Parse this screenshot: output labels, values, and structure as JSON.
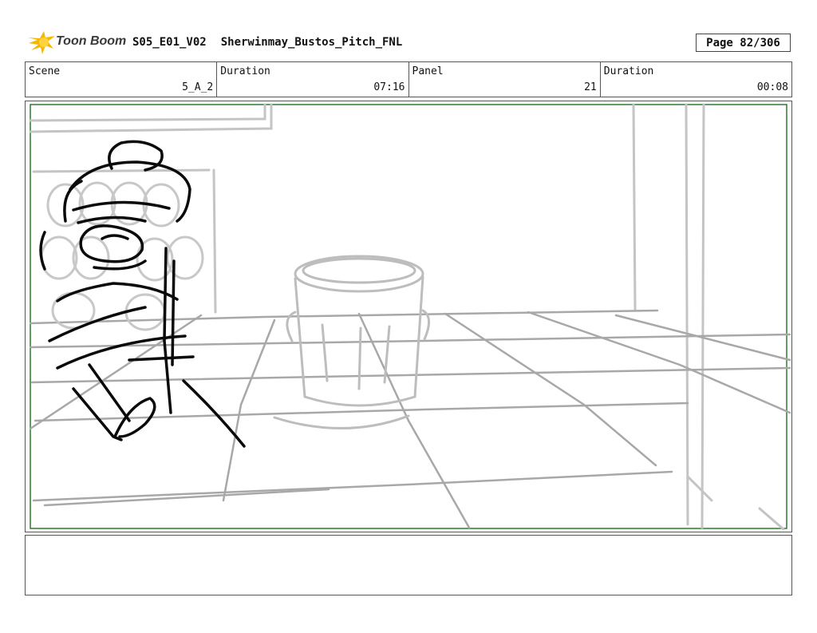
{
  "header": {
    "logo_text": "Toon Boom",
    "episode": "S05_E01_V02",
    "project": "Sherwinmay_Bustos_Pitch_FNL",
    "page": "Page  82/306"
  },
  "info_row": [
    {
      "label": "Scene",
      "value": "5_A_2"
    },
    {
      "label": "Duration",
      "value": "07:16"
    },
    {
      "label": "Panel",
      "value": "21"
    },
    {
      "label": "Duration",
      "value": "00:08"
    }
  ],
  "colors": {
    "frame_border": "#2f7a2f",
    "sketch_gray": "#c4c4c4",
    "sketch_black": "#0a0a0a",
    "logo_yellow": "#f5b800"
  },
  "icons": {
    "logo": "toon-boom-star-icon"
  }
}
